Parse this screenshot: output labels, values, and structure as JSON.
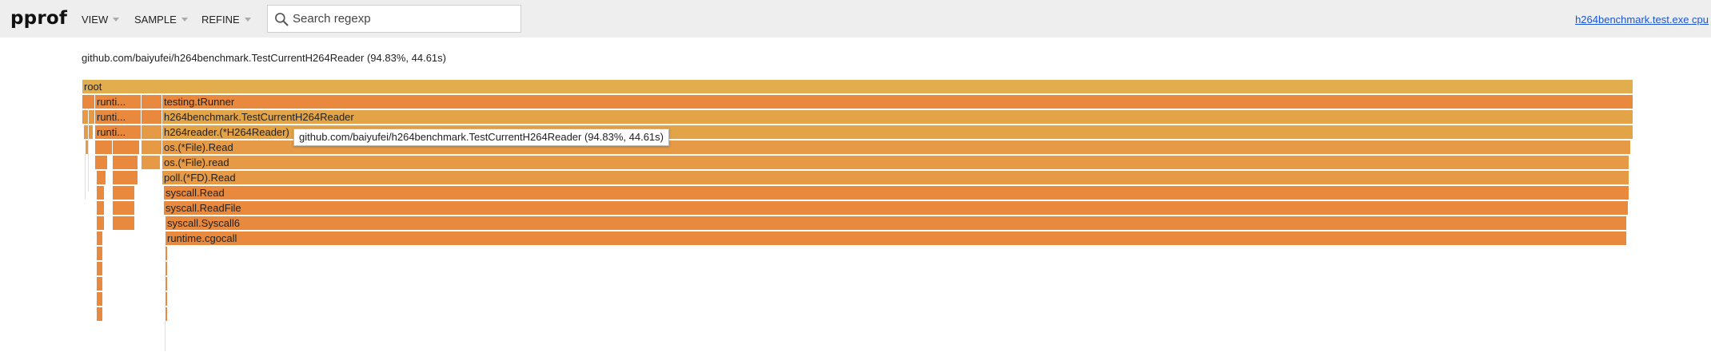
{
  "app": {
    "title": "pprof"
  },
  "menus": [
    {
      "label": "VIEW"
    },
    {
      "label": "SAMPLE"
    },
    {
      "label": "REFINE"
    }
  ],
  "search": {
    "placeholder": "Search regexp",
    "value": ""
  },
  "profile_link": "h264benchmark.test.exe cpu",
  "selected_function": "github.com/baiyufei/h264benchmark.TestCurrentH264Reader (94.83%, 44.61s)",
  "tooltip": "github.com/baiyufei/h264benchmark.TestCurrentH264Reader (94.83%, 44.61s)",
  "colors": {
    "root": "#e2ad4d",
    "frame_light": "#e3a347",
    "frame_mid": "#e69a45",
    "frame_dark": "#e8893e"
  },
  "flame": {
    "frames": [
      {
        "label": "root"
      },
      {
        "label": "testing.tRunner"
      },
      {
        "label": "h264benchmark.TestCurrentH264Reader"
      },
      {
        "label": "h264reader.(*H264Reader)"
      },
      {
        "label": "os.(*File).Read"
      },
      {
        "label": "os.(*File).read"
      },
      {
        "label": "poll.(*FD).Read"
      },
      {
        "label": "syscall.Read"
      },
      {
        "label": "syscall.ReadFile"
      },
      {
        "label": "syscall.Syscall6"
      },
      {
        "label": "runtime.cgocall"
      },
      {
        "label": "runti..."
      },
      {
        "label": "runti..."
      },
      {
        "label": "runti..."
      }
    ]
  }
}
